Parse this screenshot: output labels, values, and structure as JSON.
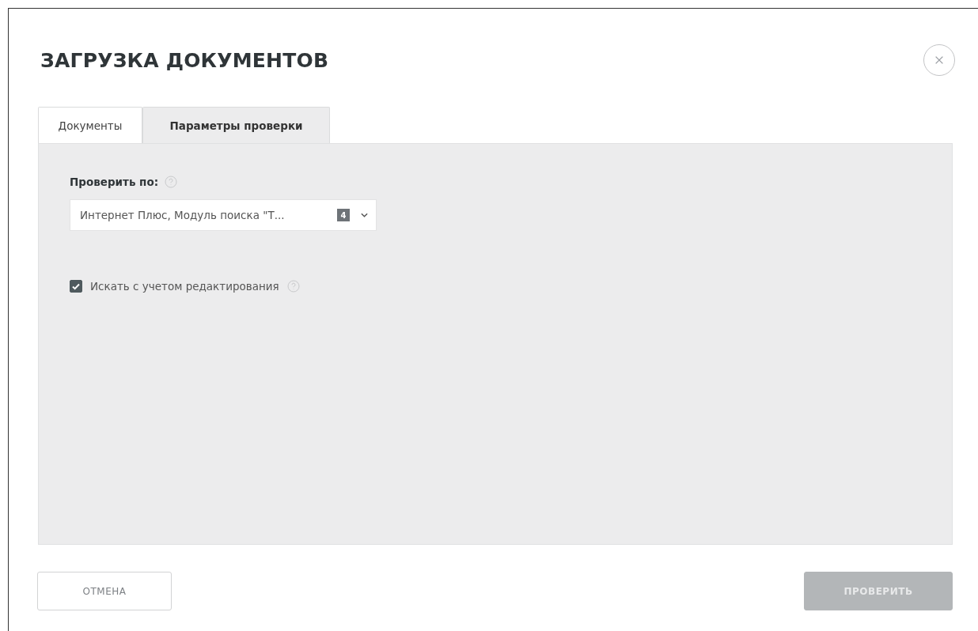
{
  "dialog": {
    "title": "ЗАГРУЗКА ДОКУМЕНТОВ"
  },
  "tabs": [
    {
      "label": "Документы",
      "selected": false
    },
    {
      "label": "Параметры проверки",
      "selected": true
    }
  ],
  "check_by": {
    "label": "Проверить по:",
    "value": "Интернет Плюс, Модуль поиска \"Т...",
    "count": "4"
  },
  "option": {
    "label": "Искать с учетом редактирования",
    "checked": true
  },
  "buttons": [
    {
      "label": "ОТМЕНА",
      "kind": "cancel",
      "disabled": false
    },
    {
      "label": "ПРОВЕРИТЬ",
      "kind": "primary",
      "disabled": true
    }
  ]
}
